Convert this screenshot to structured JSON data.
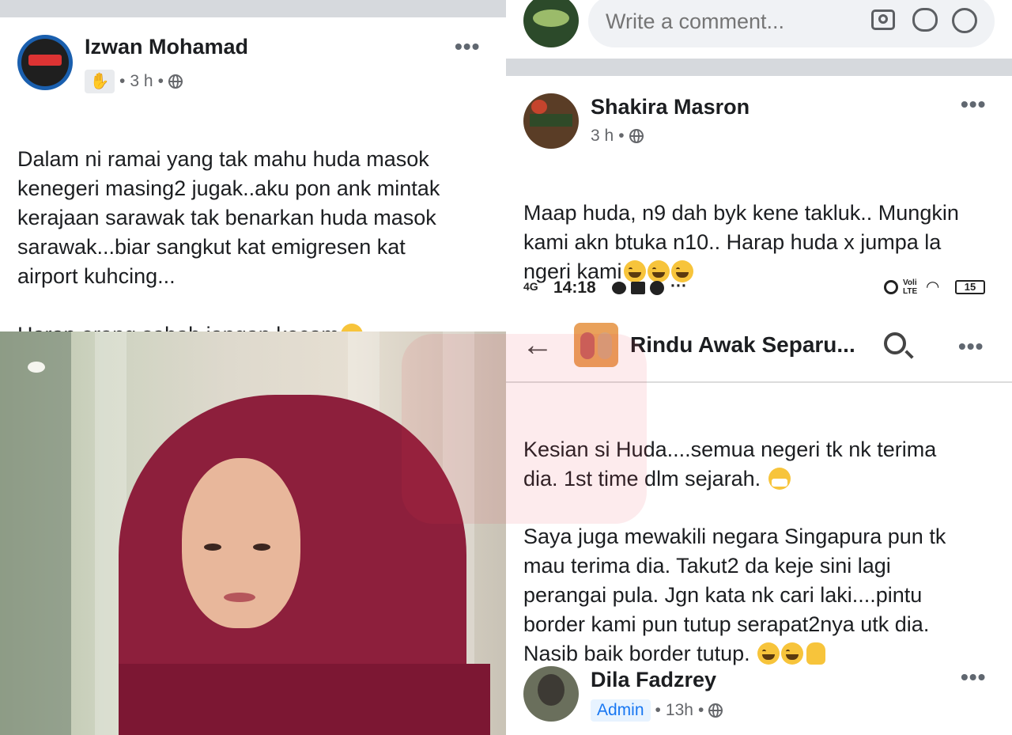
{
  "left_post": {
    "author": "Izwan Mohamad",
    "meta_time": "3 h",
    "body": "Dalam ni ramai yang tak mahu huda masok\nkenegeri masing2 jugak..aku pon ank mintak\nkerajaan sarawak tak benarkan huda masok\nsarawak...biar sangkut kat emigresen kat\nairport kuhcing...\n\nHarap orang sabah jangan kecam",
    "body_emoji": "face-with-medical-mask"
  },
  "right_top": {
    "comment_placeholder": "Write a comment...",
    "icons": [
      "camera-icon",
      "gif-icon",
      "emoji-icon"
    ]
  },
  "second_post": {
    "author": "Shakira Masron",
    "meta_time": "3 h",
    "body": "Maap huda, n9 dah byk kene takluk.. Mungkin\nkami akn btuka n10.. Harap huda x jumpa la\nngeri kami",
    "body_emoji": "laughing-face"
  },
  "status_bar": {
    "network": "4G",
    "time": "14:18",
    "volte": "Voli LTE",
    "battery": "15"
  },
  "group_nav": {
    "title": "Rindu Awak Separu..."
  },
  "third_post": {
    "body_p1": "Kesian si Huda....semua negeri tk nk terima\ndia. 1st time dlm sejarah.",
    "body_p2": "Saya juga mewakili negara Singapura pun tk\nmau terima dia. Takut2 da keje sini lagi\nperangai pula. Jgn kata nk cari laki....pintu\nborder kami pun tutup serapat2nya utk dia.\nNasib baik border tutup."
  },
  "fourth_post": {
    "author": "Dila Fadzrey",
    "role_badge": "Admin",
    "meta_time": "13h"
  },
  "colors": {
    "separator": "#d6d9dd",
    "accent_blue": "#1877f2",
    "hijab": "#8d1f3c"
  }
}
